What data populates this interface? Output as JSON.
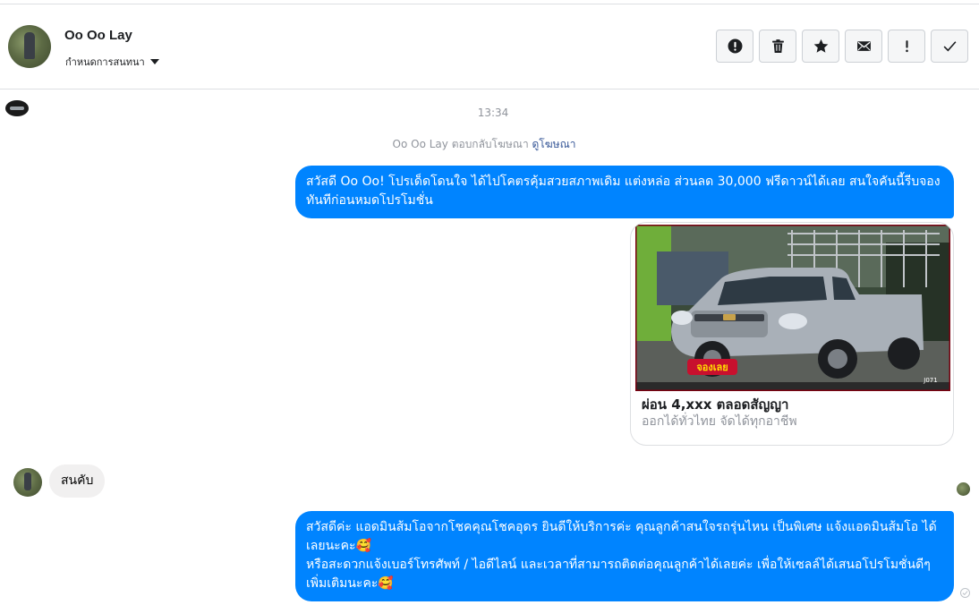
{
  "contact": {
    "name": "Oo Oo Lay",
    "manage_label": "กำหนดการสนทนา"
  },
  "toolbar": {
    "buttons": [
      {
        "name": "report-spam-button",
        "icon": "exclamation-circle-icon"
      },
      {
        "name": "delete-button",
        "icon": "trash-icon"
      },
      {
        "name": "star-button",
        "icon": "star-icon"
      },
      {
        "name": "mark-unread-button",
        "icon": "envelope-icon"
      },
      {
        "name": "follow-up-button",
        "icon": "exclamation-icon"
      },
      {
        "name": "mark-done-button",
        "icon": "checkmark-icon"
      }
    ]
  },
  "conversation": {
    "timestamp": "13:34",
    "ad_reply_text": "Oo Oo Lay ตอบกลับโฆษณา",
    "ad_reply_link": "ดูโฆษณา",
    "messages": [
      {
        "direction": "outgoing",
        "text": "สวัสดี Oo Oo! โปรเด็ดโดนใจ ได้ไปโคตรคุ้มสวยสภาพเดิม แต่งหล่อ  ส่วนลด 30,000 ฟรีดาวน์ได้เลย  สนใจคันนี้รีบจองทันทีก่อนหมดโปรโมชั่น"
      },
      {
        "direction": "ad-card",
        "title": "ผ่อน 4,xxx ตลอดสัญญา",
        "subtitle": "ออกได้ทั่วไทย จัดได้ทุกอาชีพ",
        "image_badge": "จองเลย",
        "image_code": "J071"
      },
      {
        "direction": "incoming",
        "text": "สนคับ"
      },
      {
        "direction": "outgoing",
        "text": "สวัสดีค่ะ แอดมินส้มโอจากโชคคุณโชคอุดร ยินดีให้บริการค่ะ   คุณลูกค้าสนใจรถรุ่นไหน เป็นพิเศษ แจ้งแอดมินส้มโอ ได้เลยนะคะ🥰\nหรือสะดวกแจ้งเบอร์โทรศัพท์ / ไอดีไลน์ และเวลาที่สามารถติดต่อคุณลูกค้าได้เลยค่ะ เพื่อให้เซลล์ได้เสนอโปรโมชั่นดีๆเพิ่มเติมนะคะ🥰"
      }
    ]
  },
  "colors": {
    "outgoing_bubble": "#0084ff",
    "incoming_bubble": "#f1f0f0",
    "link": "#385898",
    "muted_text": "#90949c"
  }
}
